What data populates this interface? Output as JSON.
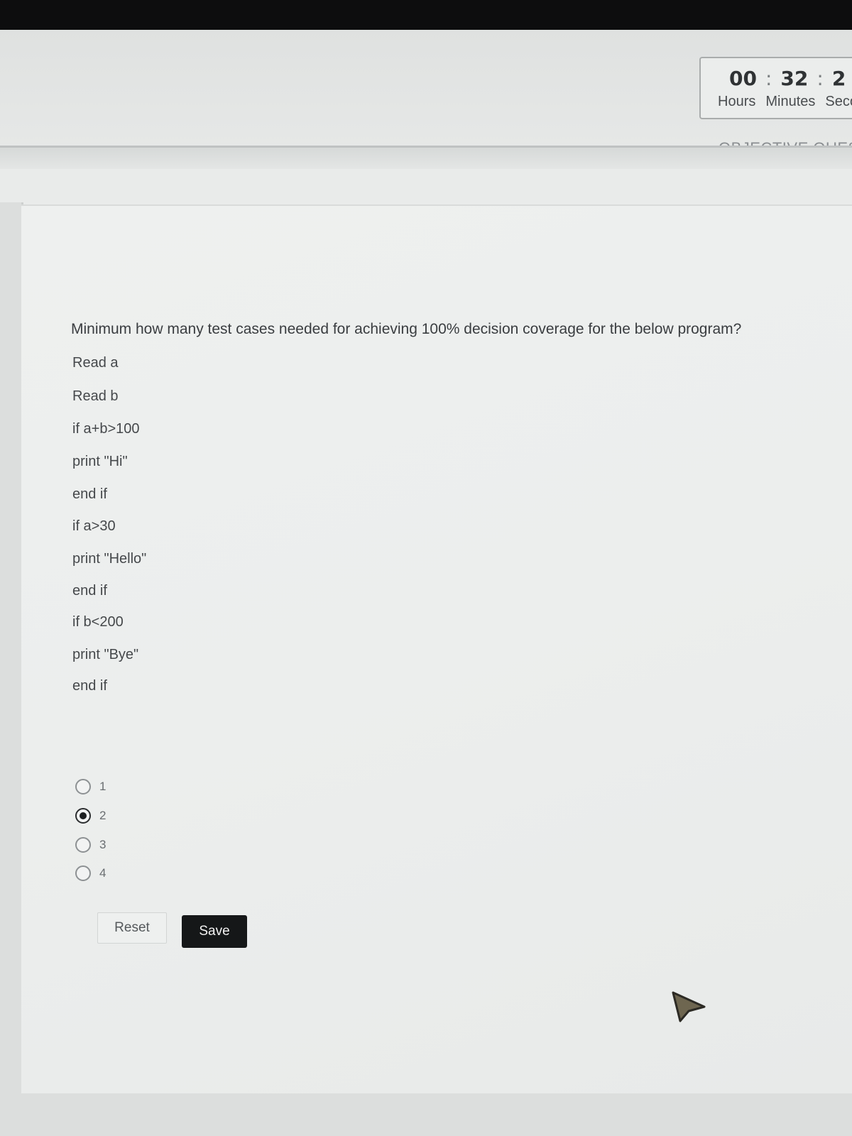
{
  "timer": {
    "hours": "00",
    "minutes": "32",
    "seconds": "2",
    "separator": ":",
    "labels": {
      "hours": "Hours",
      "minutes": "Minutes",
      "seconds": "Seco"
    }
  },
  "section_label": "OBJECTIVE QUEST",
  "question": {
    "text": "Minimum how many test cases needed for achieving 100% decision coverage for the below program?",
    "code_lines": [
      "Read a",
      "Read b",
      "if a+b>100",
      "print \"Hi\"",
      "end if",
      "if a>30",
      "print \"Hello\"",
      "end if",
      "if b<200",
      "print \"Bye\"",
      "end if"
    ]
  },
  "options": [
    {
      "label": "1",
      "selected": false
    },
    {
      "label": "2",
      "selected": true
    },
    {
      "label": "3",
      "selected": false
    },
    {
      "label": "4",
      "selected": false
    }
  ],
  "buttons": {
    "reset": "Reset",
    "save": "Save"
  },
  "icons": {
    "cursor": "mouse-pointer-icon"
  }
}
